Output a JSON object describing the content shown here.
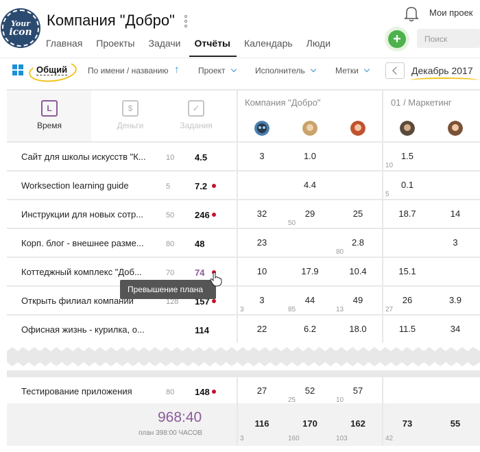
{
  "header": {
    "logo_line1": "Your",
    "logo_line2": "icon",
    "title": "Компания \"Добро\"",
    "my_projects": "Мои проек",
    "search_placeholder": "Поиск",
    "nav": [
      {
        "label": "Главная",
        "active": false
      },
      {
        "label": "Проекты",
        "active": false
      },
      {
        "label": "Задачи",
        "active": false
      },
      {
        "label": "Отчёты",
        "active": true
      },
      {
        "label": "Календарь",
        "active": false
      },
      {
        "label": "Люди",
        "active": false
      }
    ],
    "plus_label": "+"
  },
  "filters": {
    "general": "Общий",
    "sort": "По имени / названию",
    "project": "Проект",
    "assignee": "Исполнитель",
    "tags": "Метки",
    "month": "Декабрь 2017"
  },
  "tabs": [
    {
      "label": "Время",
      "glyph": "L",
      "active": true
    },
    {
      "label": "Деньги",
      "glyph": "$",
      "active": false
    },
    {
      "label": "Задания",
      "glyph": "✓",
      "active": false
    }
  ],
  "groups": [
    {
      "label": "Компания \"Добро\""
    },
    {
      "label": "01 / Маркетинг"
    }
  ],
  "rows": [
    {
      "name": "Сайт для школы искусств \"К...",
      "plan": "10",
      "total": "4.5",
      "dot": false,
      "over": false,
      "cells": [
        "3",
        "1.0",
        "",
        "1.5",
        ""
      ],
      "subs": [
        "",
        "",
        "",
        "10",
        ""
      ]
    },
    {
      "name": "Worksection learning guide",
      "plan": "5",
      "total": "7.2",
      "dot": true,
      "over": false,
      "cells": [
        "",
        "4.4",
        "",
        "0.1",
        ""
      ],
      "subs": [
        "",
        "",
        "",
        "5",
        ""
      ]
    },
    {
      "name": "Инструкции для новых сотр...",
      "plan": "50",
      "total": "246",
      "dot": true,
      "over": false,
      "cells": [
        "32",
        "29",
        "25",
        "18.7",
        "14"
      ],
      "subs": [
        "",
        "50",
        "",
        "",
        ""
      ]
    },
    {
      "name": "Корп. блог - внешнее разме...",
      "plan": "80",
      "total": "48",
      "dot": false,
      "over": false,
      "cells": [
        "23",
        "",
        "2.8",
        "",
        "3"
      ],
      "subs": [
        "",
        "",
        "80",
        "",
        ""
      ]
    },
    {
      "name": "Коттеджный комплекс \"Доб...",
      "plan": "70",
      "total": "74",
      "dot": true,
      "over": true,
      "cells": [
        "10",
        "17.9",
        "10.4",
        "15.1",
        ""
      ],
      "subs": [
        "",
        "",
        "",
        "",
        ""
      ]
    },
    {
      "name": "Открыть филиал компании",
      "plan": "128",
      "total": "157",
      "dot": true,
      "over": false,
      "cells": [
        "3",
        "44",
        "49",
        "26",
        "3.9"
      ],
      "subs": [
        "3",
        "85",
        "13",
        "27",
        ""
      ]
    },
    {
      "name": "Офисная жизнь - курилка, о...",
      "plan": "",
      "total": "114",
      "dot": false,
      "over": false,
      "cells": [
        "22",
        "6.2",
        "18.0",
        "11.5",
        "34"
      ],
      "subs": [
        "",
        "",
        "",
        "",
        ""
      ]
    },
    {
      "name": "Тестирование приложения",
      "plan": "80",
      "total": "148",
      "dot": true,
      "over": false,
      "cells": [
        "27",
        "52",
        "57",
        "",
        ""
      ],
      "subs": [
        "",
        "25",
        "10",
        "",
        ""
      ]
    }
  ],
  "tooltip": "Превышение плана",
  "summary": {
    "grand_total": "968:40",
    "plan_note": "план 398:00 ЧАСОВ",
    "cells": [
      "116",
      "170",
      "162",
      "73",
      "55"
    ],
    "subs": [
      "3",
      "160",
      "103",
      "42",
      ""
    ]
  },
  "colors": {
    "accent": "#8b5a9a",
    "overdue_dot": "#c8102e",
    "brand_blue": "#1a90d8",
    "plus_green": "#4db24b",
    "highlight": "#f2c21a"
  }
}
